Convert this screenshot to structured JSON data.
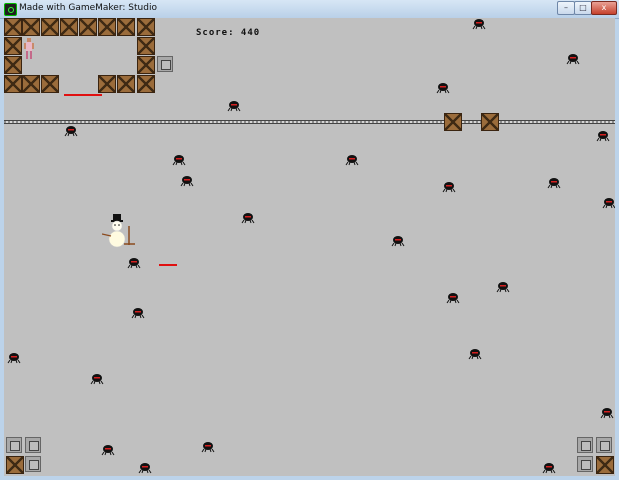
{
  "window": {
    "title": "Made with GameMaker: Studio",
    "buttons": {
      "minimize": "–",
      "maximize": "□",
      "close": "x"
    }
  },
  "hud": {
    "score_text": "Score: 440"
  },
  "sprites": {
    "player": "stickman-icon",
    "snowman": "snowman-icon",
    "enemy": "spider-icon",
    "wall": "crate-icon",
    "block": "metal-block-icon"
  },
  "colors": {
    "background": "#c0c0c0",
    "crate": "#9b6c3b",
    "red_line": "#e01010",
    "spider_body": "#111111",
    "spider_eye": "#d42020"
  }
}
